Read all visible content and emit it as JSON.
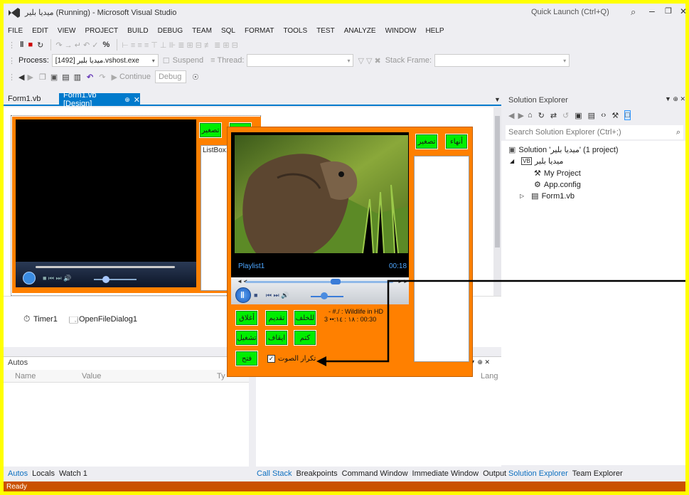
{
  "title": "ميديا بلير (Running) - Microsoft Visual Studio",
  "quick_launch": "Quick Launch (Ctrl+Q)",
  "menu": [
    "FILE",
    "EDIT",
    "VIEW",
    "PROJECT",
    "BUILD",
    "DEBUG",
    "TEAM",
    "SQL",
    "FORMAT",
    "TOOLS",
    "TEST",
    "ANALYZE",
    "WINDOW",
    "HELP"
  ],
  "debug_bar": {
    "process_label": "Process:",
    "process_value": "[1492] ميديا بلير.vshost.exe",
    "suspend": "Suspend",
    "thread_label": "Thread:",
    "stack_frame_label": "Stack Frame:"
  },
  "std_bar": {
    "continue": "Continue",
    "config": "Debug"
  },
  "tabs": [
    "Form1.vb",
    "Form1.vb [Design]"
  ],
  "designer": {
    "listbox_label": "ListBox1",
    "btn_shrink": "تصغير",
    "btn_top_partial": "إ",
    "components": [
      "Timer1",
      "OpenFileDialog1"
    ]
  },
  "running_form": {
    "btn_close": "أنهاء",
    "btn_shrink": "تصغير",
    "playlist": "Playlist1",
    "time": "00:18",
    "media_info_line1": "- #./ : Wildlife in HD",
    "media_info_line2": "3 ••:١٨ : ١٤ : 00:30",
    "buttons": [
      "للخلف",
      "تقديم",
      "أغلاق",
      "ايقاف",
      "كتم",
      "تشغيل",
      "فتح"
    ],
    "repeat_label": "تكرار الصوت",
    "repeat_checked": true
  },
  "autos": {
    "title": "Autos",
    "columns": [
      "Name",
      "Value",
      "Ty"
    ]
  },
  "bottom_left_tabs": [
    "Autos",
    "Locals",
    "Watch 1"
  ],
  "bottom_right_tabs": [
    "Call Stack",
    "Breakpoints",
    "Command Window",
    "Immediate Window",
    "Output"
  ],
  "right_lang_col": "Lang",
  "solution_explorer": {
    "title": "Solution Explorer",
    "search": "Search Solution Explorer (Ctrl+;)",
    "solution": "Solution 'ميديا بلير' (1 project)",
    "project": "ميديا بلير",
    "items": [
      "My Project",
      "App.config",
      "Form1.vb"
    ]
  },
  "se_tabs": [
    "Solution Explorer",
    "Team Explorer"
  ],
  "status": "Ready",
  "colors": {
    "orange": "#FF8000",
    "green": "#00EE00",
    "status": "#CA5100",
    "accent": "#007ACC"
  }
}
